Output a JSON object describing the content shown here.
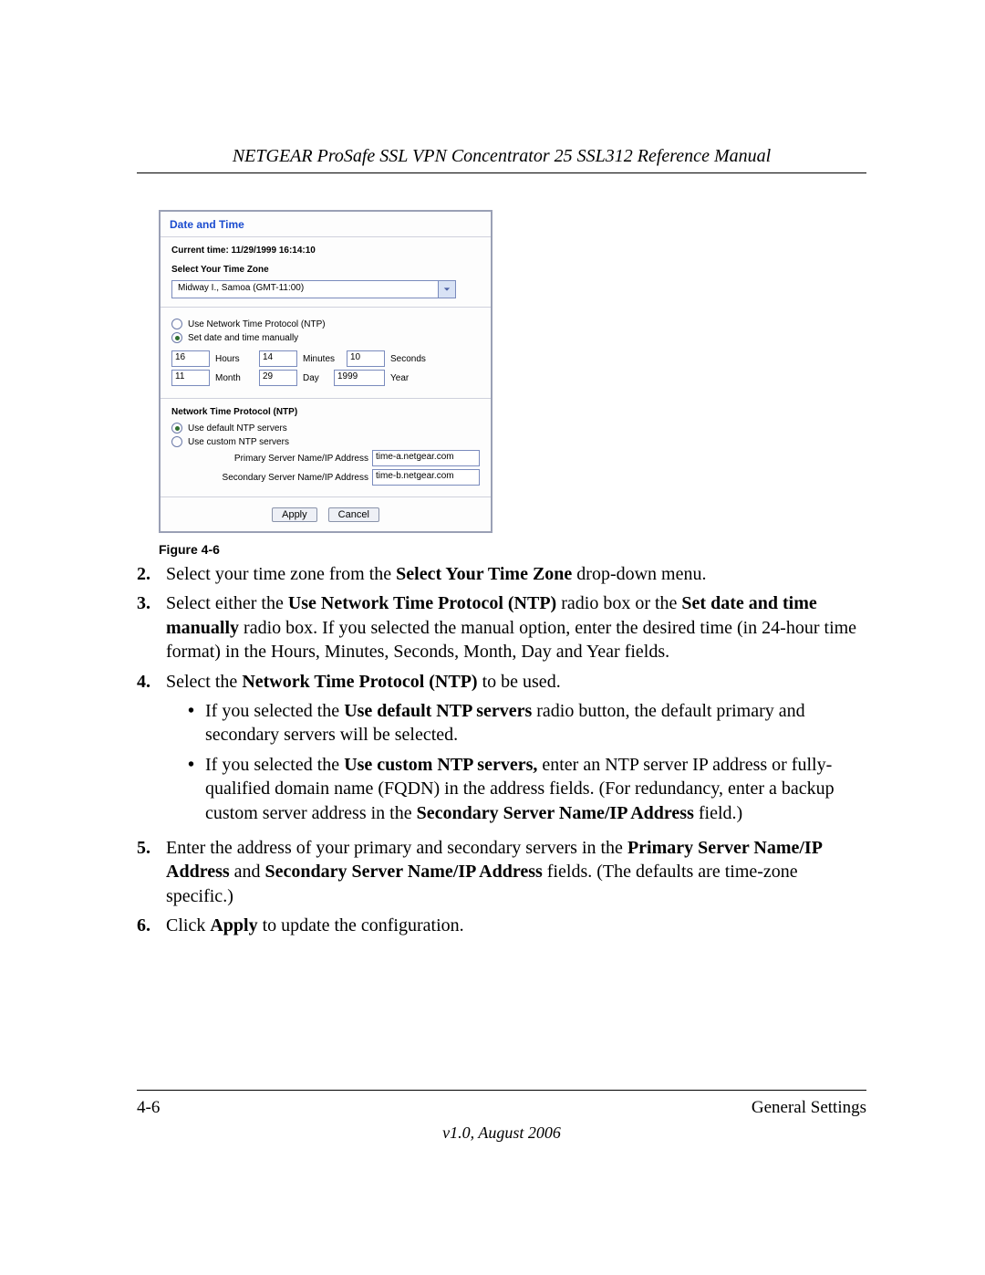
{
  "header": {
    "title": "NETGEAR ProSafe SSL VPN Concentrator 25 SSL312 Reference Manual"
  },
  "panel": {
    "heading": "Date and Time",
    "current_time": "Current time: 11/29/1999 16:14:10",
    "tz_label": "Select Your Time Zone",
    "tz_value": "Midway I., Samoa (GMT-11:00)",
    "ntp_source": {
      "option_ntp": "Use Network Time Protocol (NTP)",
      "option_manual": "Set date and time manually"
    },
    "time_fields": {
      "hours": "16",
      "hours_lbl": "Hours",
      "minutes": "14",
      "minutes_lbl": "Minutes",
      "seconds": "10",
      "seconds_lbl": "Seconds",
      "month": "11",
      "month_lbl": "Month",
      "day": "29",
      "day_lbl": "Day",
      "year": "1999",
      "year_lbl": "Year"
    },
    "ntp_section": {
      "heading": "Network Time Protocol (NTP)",
      "option_default": "Use default NTP servers",
      "option_custom": "Use custom NTP servers",
      "primary_lbl": "Primary Server Name/IP Address",
      "primary_val": "time-a.netgear.com",
      "secondary_lbl": "Secondary Server Name/IP Address",
      "secondary_val": "time-b.netgear.com"
    },
    "buttons": {
      "apply": "Apply",
      "cancel": "Cancel"
    }
  },
  "caption": "Figure 4-6",
  "steps": {
    "n2": {
      "num": "2.",
      "a": "Select your time zone from the ",
      "b": "Select Your Time Zone",
      "c": " drop-down menu."
    },
    "n3": {
      "num": "3.",
      "a": "Select either the ",
      "b": "Use Network Time Protocol (NTP)",
      "c": " radio box or the ",
      "d": "Set date and time manually",
      "e": " radio box. If you selected the manual option, enter the desired time (in 24-hour time format) in the Hours, Minutes, Seconds, Month, Day and Year fields."
    },
    "n4": {
      "num": "4.",
      "a": "Select the ",
      "b": "Network Time Protocol (NTP)",
      "c": " to be used.",
      "bul1": {
        "a": "If you selected the ",
        "b": "Use default NTP servers",
        "c": " radio button, the default primary and secondary servers will be selected."
      },
      "bul2": {
        "a": "If you selected the ",
        "b": "Use custom NTP servers,",
        "c": " enter an NTP server IP address or fully-qualified domain name (FQDN) in the address fields. (For redundancy, enter a backup custom server address in the ",
        "d": "Secondary Server Name/IP Address",
        "e": " field.)"
      }
    },
    "n5": {
      "num": "5.",
      "a": "Enter the address of your primary and secondary servers in the ",
      "b": "Primary Server Name/IP Address",
      "c": " and ",
      "d": "Secondary Server Name/IP Address",
      "e": " fields. (The defaults are time-zone specific.)"
    },
    "n6": {
      "num": "6.",
      "a": "Click ",
      "b": "Apply",
      "c": " to update the configuration."
    }
  },
  "footer": {
    "page": "4-6",
    "section": "General Settings",
    "version": "v1.0, August 2006"
  }
}
